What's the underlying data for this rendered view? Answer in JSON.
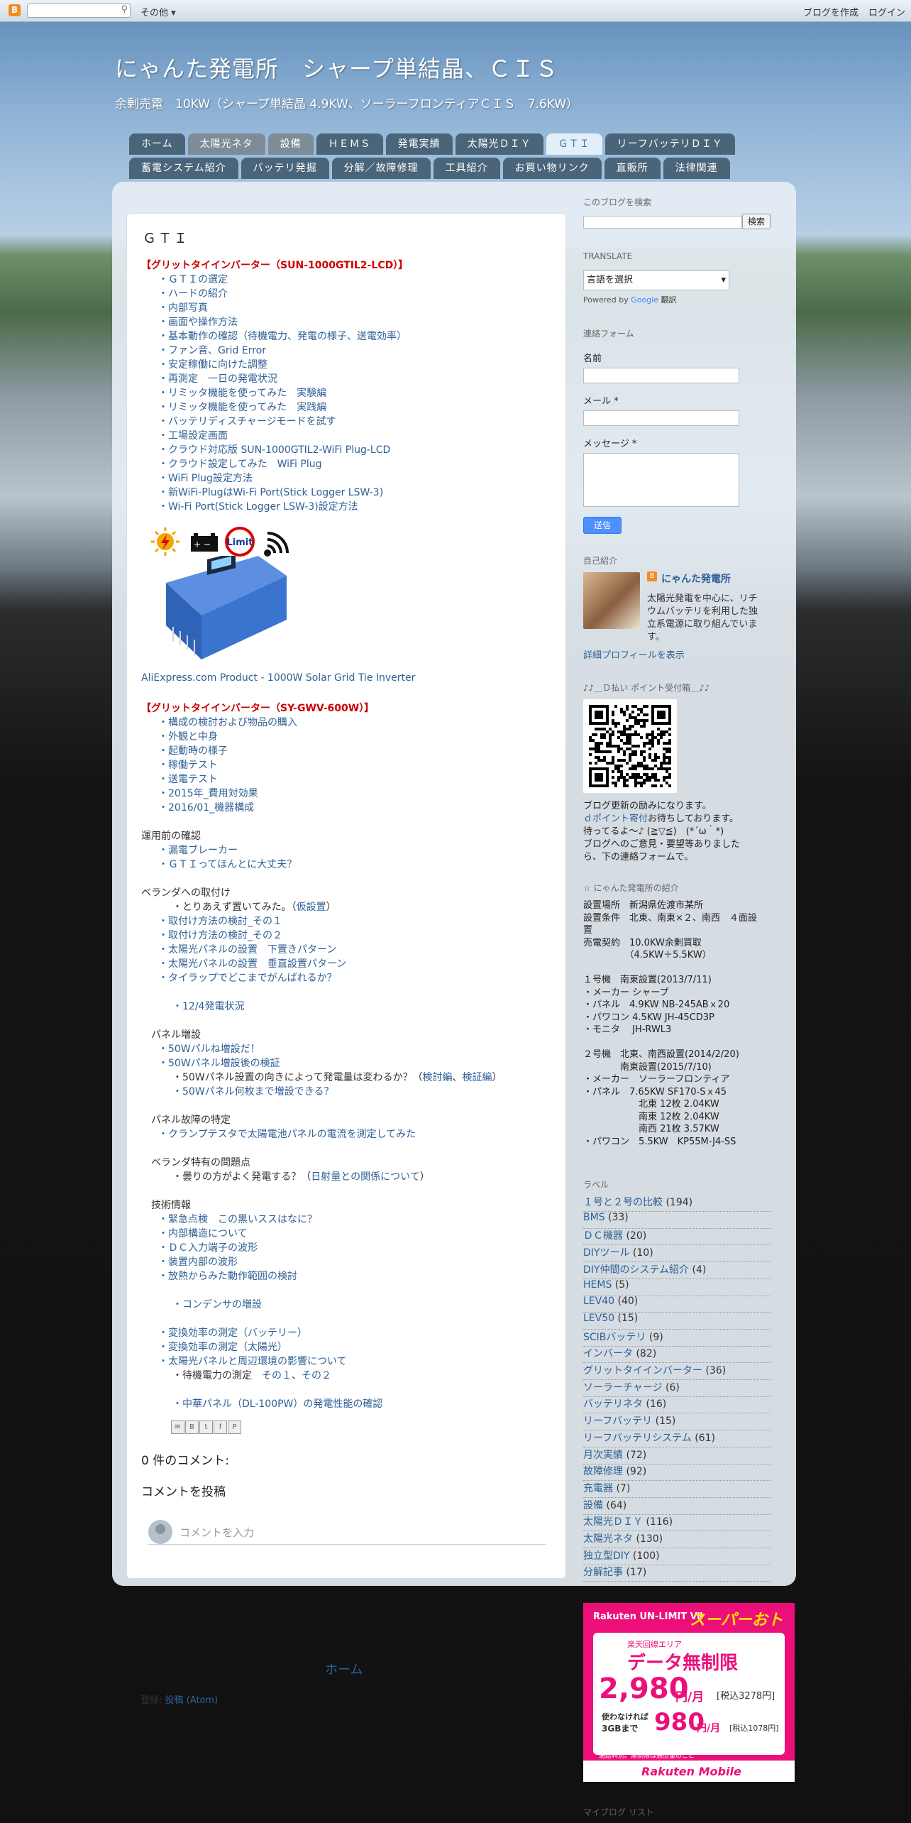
{
  "topbar": {
    "search_placeholder": "",
    "more": "その他 ▾",
    "create": "ブログを作成",
    "login": "ログイン"
  },
  "header": {
    "title": "にゃんた発電所　シャープ単結晶、ＣＩＳ",
    "description": "余剰売電　10KW（シャープ単結晶 4.9KW、ソーラーフロンティアＣＩＳ　7.6KW）"
  },
  "tabs_row1": [
    "ホーム",
    "太陽光ネタ",
    "設備",
    "ＨＥＭＳ",
    "発電実績",
    "太陽光ＤＩＹ",
    "ＧＴＩ",
    "リーフバッテリＤＩＹ"
  ],
  "tabs_row2": [
    "蓄電システム紹介",
    "バッテリ発掘",
    "分解／故障修理",
    "工具紹介",
    "お買い物リンク",
    "直販所",
    "法律関連"
  ],
  "post": {
    "title": "ＧＴＩ",
    "sec1_title": "【グリットタイインバーター（SUN-1000GTIL2-LCD）】",
    "sec1_items": [
      "・ＧＴＩの選定",
      "・ハードの紹介",
      "・内部写真",
      "・画面や操作方法",
      "・基本動作の確認（待機電力、発電の様子、送電効率）",
      "・ファン音、Grid Error",
      "・安定稼働に向けた調整",
      "・再測定　一日の発電状況",
      "・リミッタ機能を使ってみた　実験編",
      "・リミッタ機能を使ってみた　実践編",
      "・バッテリディスチャージモードを試す",
      "・工場設定画面",
      "・クラウド対応版 SUN-1000GTIL2-WiFi Plug-LCD",
      "・クラウド設定してみた　WiFi Plug",
      "・WiFi Plug設定方法",
      "・新WiFi-PlugはWi-Fi Port(Stick Logger LSW-3)",
      "・Wi-Fi Port(Stick Logger LSW-3)設定方法"
    ],
    "icons": [
      "sun-icon",
      "battery-icon",
      "limit-icon",
      "wifi-icon"
    ],
    "icon_limit_text": "Limit",
    "aliexpress": "AliExpress.com Product - 1000W Solar Grid Tie Inverter",
    "sec2_title": "【グリットタイインバーター（SY-GWV-600W）】",
    "sec2_items": [
      "・構成の検討および物品の購入",
      "・外観と中身",
      "・起動時の様子",
      "・稼働テスト",
      "・送電テスト",
      "・2015年_費用対効果",
      "・2016/01_機器構成"
    ],
    "sec3_title": "運用前の確認",
    "sec3_items": [
      "・漏電ブレーカー",
      "・ＧＴＩってほんとに大丈夫？"
    ],
    "sec4_title": "ベランダへの取付け",
    "sec4_a_pre": "・とりあえず置いてみた。（",
    "sec4_a_link": "仮設置",
    "sec4_a_post": "）",
    "sec4_items": [
      "・取付け方法の検討_その１",
      "・取付け方法の検討_その２",
      "・太陽光パネルの設置　下置きパターン",
      "・太陽光パネルの設置　垂直設置パターン",
      "・タイラップでどこまでがんばれるか？"
    ],
    "sec4_tail": "・12/4発電状況",
    "sec5_title": "パネル増設",
    "sec5_items": [
      "・50Wパルね増設だ！",
      "・50Wパネル増設後の検証"
    ],
    "sec5_c_pre": "・50Wパネル設置の向きによって発電量は変わるか？（",
    "sec5_c_link1": "検討編",
    "sec5_c_sep": "、",
    "sec5_c_link2": "検証編",
    "sec5_c_post": "）",
    "sec5_d": "・50Wパネル何枚まで増設できる？",
    "sec6_title": "パネル故障の特定",
    "sec6_items": [
      "・クランプテスタで太陽電池パネルの電流を測定してみた"
    ],
    "sec7_title": "ベランダ特有の問題点",
    "sec7_pre": "・曇りの方がよく発電する？（",
    "sec7_link": "日射量との関係について",
    "sec7_post": "）",
    "sec8_title": "技術情報",
    "sec8_items": [
      "・緊急点検　この黒いススはなに？",
      "・内部構造について",
      "・ＤＣ入力端子の波形",
      "・装置内部の波形",
      "・放熱からみた動作範囲の検討"
    ],
    "sec8_cap": "・コンデンサの増設",
    "sec8_items2": [
      "・変換効率の測定（バッテリー）",
      "・変換効率の測定（太陽光）",
      "・太陽光パネルと周辺環境の影響について"
    ],
    "sec8_wait_pre": "・待機電力の測定　",
    "sec8_wait_l1": "その１",
    "sec8_wait_sep": "、",
    "sec8_wait_l2": "その２",
    "sec8_last": "・中華パネル（DL-100PW）の発電性能の確認",
    "share": [
      "✉",
      "B",
      "t",
      "f",
      "P"
    ],
    "comments_count": "0 件のコメント:",
    "comment_post": "コメントを投稿",
    "comment_placeholder": "コメントを入力"
  },
  "footer": {
    "home": "ホーム",
    "atom_pre": "登録: ",
    "atom_link": "投稿 (Atom)"
  },
  "sidebar": {
    "search_title": "このブログを検索",
    "search_btn": "検索",
    "translate_title": "TRANSLATE",
    "translate_select": "言語を選択",
    "powered_pre": "Powered by",
    "powered_google": "Google",
    "powered_post": "翻訳",
    "contact_title": "連絡フォーム",
    "name_label": "名前",
    "email_label": "メール *",
    "message_label": "メッセージ *",
    "send": "送信",
    "profile_title": "自己紹介",
    "profile_name": "にゃんた発電所",
    "profile_desc": [
      "太陽光発電を中心に、リチ",
      "ウムバッテリを利用した独",
      "立系電源に取り組んでいま",
      "す。"
    ],
    "profile_link": "詳細プロフィールを表示",
    "dpoint_title": "♪♪＿Ｄ払い ポイント受付箱＿♪♪",
    "dpoint_text1": "ブログ更新の励みになります。",
    "dpoint_link": "ｄポイント寄付",
    "dpoint_text2": "お待ちしております。",
    "dpoint_text3": "待ってるよ～♪ (≧▽≦)　(*´ω｀*)",
    "dpoint_text4": "ブログへのご意見・要望等ありました",
    "dpoint_text5": "ら、下の連絡フォームで。",
    "intro_title": "☆ にゃんた発電所の紹介",
    "intro_lines": [
      "設置場所　新潟県佐渡市某所",
      "設置条件　北東、南東×２、南西　４面設",
      "置",
      "売電契約　10.0KW余剰買取",
      "　　　　　（4.5KW＋5.5KW）",
      "",
      "１号機　南東設置(2013/7/11)",
      "・メーカー シャープ",
      "・パネル　4.9KW NB-245ABｘ20",
      "・パワコン 4.5KW JH-45CD3P",
      "・モニタ　 JH-RWL3",
      "",
      "２号機　北東、南西設置(2014/2/20)",
      "　　　　南東設置(2015/7/10)",
      "・メーカー　ソーラーフロンティア",
      "・パネル　7.65KW SF170-Sｘ45",
      "　　　　　　北東 12枚 2.04KW",
      "　　　　　　南東 12枚 2.04KW",
      "　　　　　　南西 21枚 3.57KW",
      "・パワコン　5.5KW　KP55M-J4-SS"
    ],
    "labels_title": "ラベル",
    "labels": [
      {
        "name": "１号と２号の比較",
        "count": "(194)"
      },
      {
        "name": "BMS",
        "count": "(33)"
      },
      {
        "name": "ＤＣ機器",
        "count": "(20)"
      },
      {
        "name": "DIYツール",
        "count": "(10)"
      },
      {
        "name": "DIY仲間のシステム紹介",
        "count": "(4)"
      },
      {
        "name": "HEMS",
        "count": "(5)"
      },
      {
        "name": "LEV40",
        "count": "(40)"
      },
      {
        "name": "LEV50",
        "count": "(15)"
      },
      {
        "name": "SCIBバッテリ",
        "count": "(9)"
      },
      {
        "name": "インバータ",
        "count": "(82)"
      },
      {
        "name": "グリットタイインバーター",
        "count": "(36)"
      },
      {
        "name": "ソーラーチャージ",
        "count": "(6)"
      },
      {
        "name": "バッテリネタ",
        "count": "(16)"
      },
      {
        "name": "リーフバッテリ",
        "count": "(15)"
      },
      {
        "name": "リーフバッテリシステム",
        "count": "(61)"
      },
      {
        "name": "月次実績",
        "count": "(72)"
      },
      {
        "name": "故障修理",
        "count": "(92)"
      },
      {
        "name": "充電器",
        "count": "(7)"
      },
      {
        "name": "設備",
        "count": "(64)"
      },
      {
        "name": "太陽光ＤＩＹ",
        "count": "(116)"
      },
      {
        "name": "太陽光ネタ",
        "count": "(130)"
      },
      {
        "name": "独立型DIY",
        "count": "(100)"
      },
      {
        "name": "分解記事",
        "count": "(17)"
      }
    ],
    "ad": {
      "brand": "Rakuten UN-LIMIT Ⅶ",
      "badge": "スーパーおトク",
      "area": "楽天回線エリア",
      "data": "データ無制限",
      "price": "2,980",
      "unit": "円/月",
      "tax": "[税込3278円]",
      "cond1": "使わなければ",
      "cond2": "3GBまで",
      "price2": "980",
      "unit2": "円/月",
      "tax2": "[税込1078円]",
      "note1": "※1 無制限は楽天回線エリアのみ。エリア外は最大1Mbps。",
      "note2": "通話料別。無制限は通信量のこと",
      "footer": "Rakuten Mobile"
    },
    "myblog_title": "マイブログ リスト"
  }
}
